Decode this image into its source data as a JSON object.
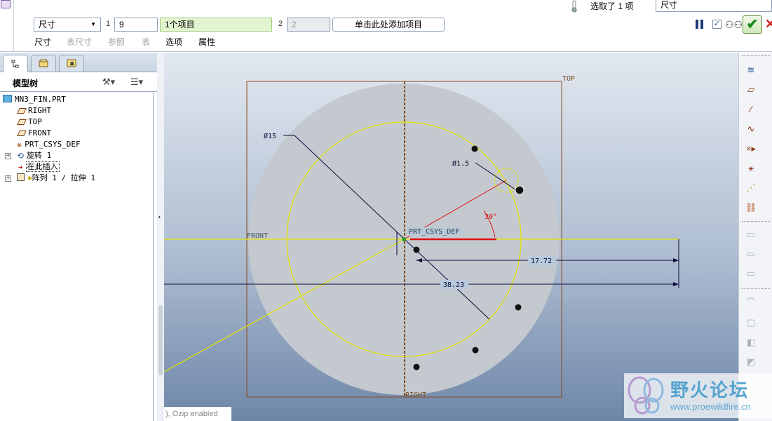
{
  "dashboard": {
    "type_select": "尺寸",
    "field1_index": "1",
    "field1_value": "9",
    "collector": "1个项目",
    "field2_index": "2",
    "field2_value": "2",
    "add_item": "单击此处添加项目",
    "tabs": [
      "尺寸",
      "表尺寸",
      "参照",
      "表",
      "选项",
      "属性"
    ],
    "selection_status": "选取了 1 项",
    "filter_value": "尺寸"
  },
  "model_tree": {
    "title": "模型树",
    "nodes": [
      {
        "label": "MN3_FIN.PRT"
      },
      {
        "label": "RIGHT"
      },
      {
        "label": "TOP"
      },
      {
        "label": "FRONT"
      },
      {
        "label": "PRT_CSYS_DEF"
      },
      {
        "label": "旋转 1"
      },
      {
        "label": "在此插入"
      },
      {
        "label": "阵列 1 / 拉伸 1"
      }
    ]
  },
  "graphics": {
    "top_label": "TOP",
    "front_label": "FRONT",
    "right_label": "RIGHT",
    "csys_label": "PRT_CSYS_DEF",
    "dim_dia_large": "Ø15",
    "dim_dia_small": "Ø1.5",
    "dim_angle": "30°",
    "dim_horizontal": "17.72",
    "dim_diagonal": "38.23",
    "status_text": "), Ozip enabled"
  },
  "watermark": {
    "title": "野火论坛",
    "url": "www.proewildfire.cn"
  }
}
